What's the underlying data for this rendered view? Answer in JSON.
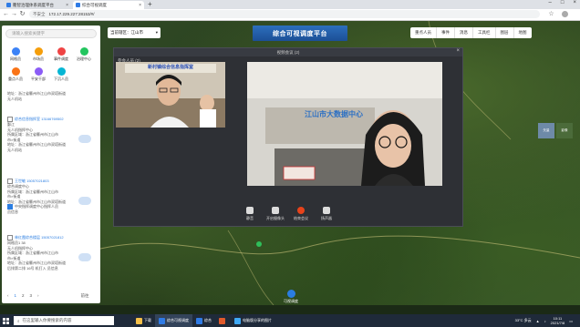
{
  "browser": {
    "tabs": [
      {
        "label": "衢智治理体系调度平台"
      },
      {
        "label": "综合可视调度"
      }
    ],
    "new_tab": "+",
    "security": "不安全",
    "url": "172.17.229.227:28153/#/",
    "window_controls": [
      "–",
      "□",
      "×"
    ]
  },
  "topbar": {
    "portal_label": "当前辖区：江山市",
    "title": "综合可视调度平台",
    "menu": [
      {
        "label": "重点人员"
      },
      {
        "label": "事件"
      },
      {
        "label": "消息"
      },
      {
        "label": "工具栏"
      },
      {
        "label": "图层"
      },
      {
        "label": "地图"
      }
    ]
  },
  "leftpanel": {
    "search_placeholder": "请输入搜索关键字",
    "categories": [
      {
        "label": "网格员",
        "color": "#3b82f6"
      },
      {
        "label": "市场员",
        "color": "#f59e0b"
      },
      {
        "label": "事件调度",
        "color": "#ef4444"
      },
      {
        "label": "治理中心",
        "color": "#22c55e"
      },
      {
        "label": "重点人员",
        "color": "#f97316"
      },
      {
        "label": "平安干部",
        "color": "#8b5cf6"
      },
      {
        "label": "下沉人员",
        "color": "#06b6d4"
      }
    ],
    "cards": [
      {
        "name": "",
        "lines": [
          "地址：浙江省衢州市江山市双塔街道",
          "无人机站"
        ]
      },
      {
        "name": "综合信息指挥室  13166769502",
        "lines": [
          "鄞江",
          "无人机指挥中心",
          "所属区域：浙江省衢州市江山市",
          "市×街道",
          "地址：浙江省衢州市江山市双塔街道",
          "无人机站"
        ]
      },
      {
        "name": "王世敏    15057021803",
        "lines": [
          "综合调度中心",
          "所属区域：浙江省衢州市江山市",
          "市×街道",
          "地址：浙江省衢州市江山市双塔街道",
          "中央指挥调度中心指挥人员",
          "员信息"
        ]
      },
      {
        "name": "林红霞综合楼层    15057021812",
        "lines": [
          "网格员1    38",
          "无人机指挥中心",
          "所属区域：浙江省衢州市江山市",
          "市×街道",
          "地址：浙江省衢州市江山市双塔街道",
          "后排第二排 16号 机打入 员信息"
        ]
      }
    ],
    "pager": {
      "pages": [
        "1",
        "2",
        "3"
      ],
      "more": "前往"
    }
  },
  "dialog": {
    "title": "视频会议 (2)",
    "close": "×",
    "members_label": "参会人员 (2)",
    "video1_banner": "新村镇综合信息指挥室",
    "video2_banner": "江山市大数据中心",
    "controls": [
      {
        "label": "静音"
      },
      {
        "label": "开启摄像头"
      },
      {
        "label": "结束会议"
      },
      {
        "label": "扬声器"
      }
    ]
  },
  "map": {
    "styles": [
      "矢量",
      "影像"
    ],
    "video_button_label": "可视调度"
  },
  "taskbar": {
    "search_placeholder": "在这里输入你要搜索的内容",
    "apps": [
      {
        "label": "下载",
        "color": "#f5c04a"
      },
      {
        "label": "综合可视调度",
        "color": "#2f7be5"
      },
      {
        "label": "综合",
        "color": "#2f7be5"
      },
      {
        "label": "",
        "color": "#e05a2b"
      },
      {
        "label": "电脑版分享的图片",
        "color": "#3fa9f5"
      }
    ],
    "weather": "33°C 多云",
    "time": "10:11",
    "date": "2021/7/8"
  }
}
